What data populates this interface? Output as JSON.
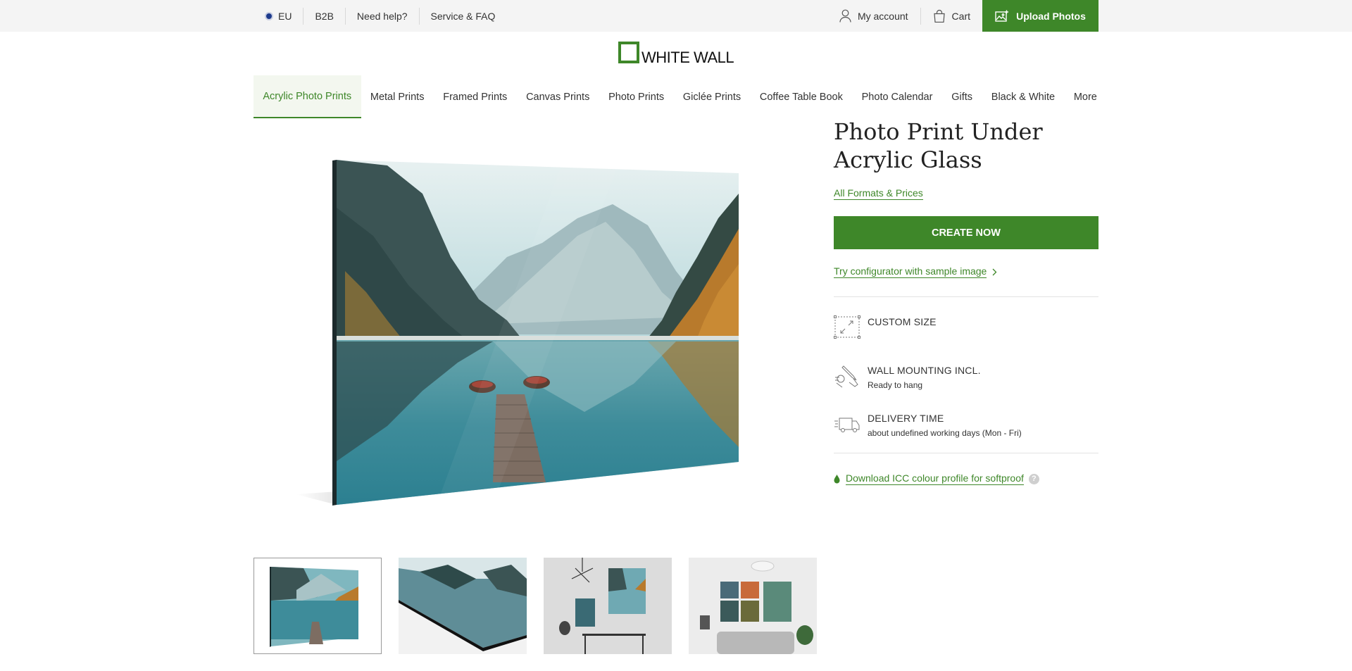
{
  "topbar": {
    "left_items": [
      "EU",
      "B2B",
      "Need help?",
      "Service & FAQ"
    ],
    "account_label": "My account",
    "cart_label": "Cart",
    "upload_label": "Upload Photos"
  },
  "logo": {
    "text": "WHITE WALL"
  },
  "nav": {
    "items": [
      "Acrylic Photo Prints",
      "Metal Prints",
      "Framed Prints",
      "Canvas Prints",
      "Photo Prints",
      "Giclée Prints",
      "Coffee Table Book",
      "Photo Calendar",
      "Gifts",
      "Black & White",
      "More"
    ],
    "active_index": 0
  },
  "product": {
    "title": "Photo Print Under Acrylic Glass",
    "formats_link": "All Formats & Prices",
    "create_button": "CREATE NOW",
    "try_link": "Try configurator with sample image",
    "features": [
      {
        "icon": "resize-icon",
        "title": "CUSTOM SIZE",
        "sub": ""
      },
      {
        "icon": "wall-mount-icon",
        "title": "WALL MOUNTING INCL.",
        "sub": "Ready to hang"
      },
      {
        "icon": "delivery-truck-icon",
        "title": "DELIVERY TIME",
        "sub": "about undefined working days (Mon - Fri)"
      }
    ],
    "icc_link": "Download ICC colour profile for softproof",
    "help_symbol": "?"
  },
  "thumbnails": [
    "acrylic-print-front",
    "acrylic-edge-detail",
    "acrylic-wall-room",
    "acrylic-living-room-gallery"
  ],
  "colors": {
    "accent": "#3e8729",
    "topbar_bg": "#f4f4f4",
    "nav_active_bg": "#f3f7ef"
  }
}
